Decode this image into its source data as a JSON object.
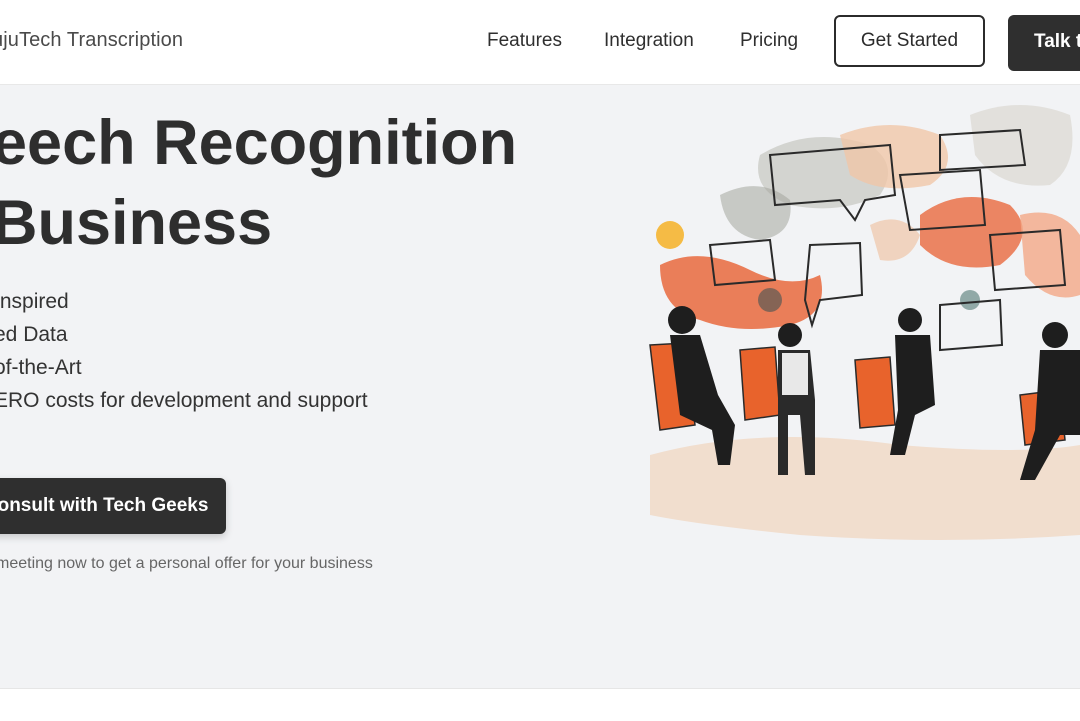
{
  "header": {
    "brand": "ujuTech Transcription",
    "nav": [
      {
        "label": "Features"
      },
      {
        "label": "Integration"
      },
      {
        "label": "Pricing"
      }
    ],
    "get_started_label": "Get Started",
    "talk_label": "Talk t"
  },
  "hero": {
    "title_line1": "eech Recognition",
    "title_line2": " Business",
    "features": [
      "Inspired",
      "ed Data",
      "of-the-Art",
      "ERO costs for development and support"
    ],
    "cta_label": "onsult with Tech Geeks",
    "note": "meeting now to get a personal offer for your business"
  },
  "colors": {
    "accent_dark": "#2f2f2f",
    "hero_bg": "#f2f3f5",
    "illustration_orange": "#e85a2a",
    "illustration_peach": "#f0c2a0"
  }
}
